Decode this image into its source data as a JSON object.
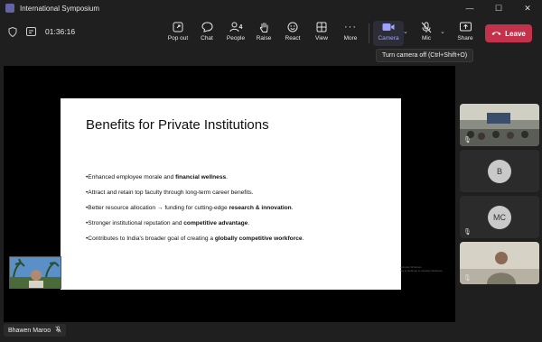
{
  "window": {
    "title": "International Symposium",
    "controls": [
      "—",
      "☐",
      "✕"
    ]
  },
  "meeting": {
    "timer": "01:36:16"
  },
  "toolbar": {
    "popout": "Pop out",
    "chat": "Chat",
    "people": "People",
    "people_count": "4",
    "raise": "Raise",
    "react": "React",
    "view": "View",
    "more": "More",
    "camera": "Camera",
    "mic": "Mic",
    "share": "Share",
    "leave": "Leave"
  },
  "tooltip": "Turn camera off (Ctrl+Shift+O)",
  "slide": {
    "title": "Benefits for Private Institutions",
    "bullets": [
      {
        "pre": "•Enhanced employee morale and ",
        "bold": "financial wellness",
        "post": "."
      },
      {
        "pre": "•Attract and retain top faculty through long-term career benefits.",
        "bold": "",
        "post": ""
      },
      {
        "pre": "•Better resource allocation → funding for cutting-edge ",
        "bold": "research & innovation",
        "post": "."
      },
      {
        "pre": "•Stronger institutional reputation and ",
        "bold": "competitive advantage",
        "post": "."
      },
      {
        "pre": "•Contributes to India's broader goal of creating a ",
        "bold": "globally competitive workforce",
        "post": "."
      }
    ]
  },
  "watermark": {
    "line1": "Activate Windows",
    "line2": "Go to Settings to activate Windows."
  },
  "participants": [
    {
      "kind": "video",
      "label": "room"
    },
    {
      "kind": "avatar",
      "initials": "B"
    },
    {
      "kind": "avatar",
      "initials": "MC"
    },
    {
      "kind": "video",
      "label": "person"
    }
  ],
  "presenter": {
    "name": "Bhawen Maroo"
  },
  "colors": {
    "leave": "#c4314b",
    "accent": "#6264a7",
    "background": "#1f1f1f"
  }
}
